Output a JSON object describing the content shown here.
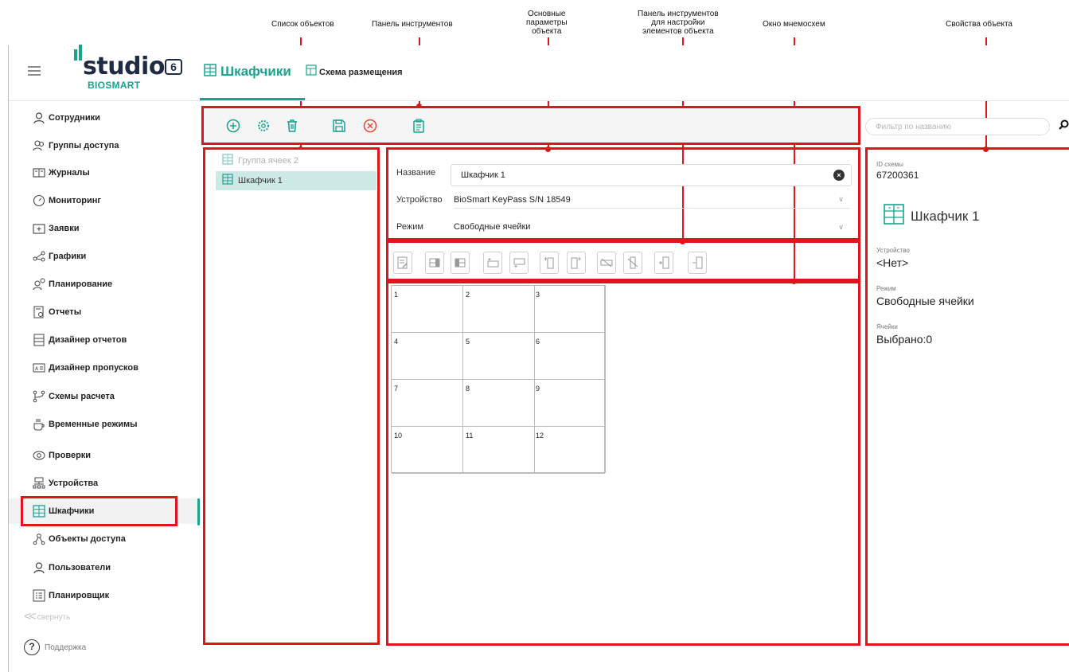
{
  "callouts": {
    "object_list": "Список объектов",
    "toolbar": "Панель инструментов",
    "main_params_1": "Основные",
    "main_params_2": "параметры",
    "main_params_3": "объекта",
    "element_toolbar_1": "Панель инструментов",
    "element_toolbar_2": "для настройки",
    "element_toolbar_3": "элементов объекта",
    "mnemonic_window": "Окно мнемосхем",
    "object_properties": "Свойства объекта"
  },
  "logo": {
    "word": "studio",
    "version": "6",
    "sub": "BIOSMART"
  },
  "tabs": [
    {
      "label": "Шкафчики",
      "icon": "locker-grid-icon",
      "active": true
    },
    {
      "label": "Схема размещения",
      "icon": "layout-scheme-icon",
      "active": false
    }
  ],
  "sidebar": {
    "items": [
      {
        "label": "Сотрудники",
        "icon": "person-icon"
      },
      {
        "label": "Группы доступа",
        "icon": "group-icon"
      },
      {
        "label": "Журналы",
        "icon": "journal-icon"
      },
      {
        "label": "Мониторинг",
        "icon": "gauge-icon"
      },
      {
        "label": "Заявки",
        "icon": "request-icon"
      },
      {
        "label": "Графики",
        "icon": "schedule-icon"
      },
      {
        "label": "Планирование",
        "icon": "planning-icon"
      },
      {
        "label": "Отчеты",
        "icon": "report-icon"
      },
      {
        "label": "Дизайнер отчетов",
        "icon": "report-designer-icon"
      },
      {
        "label": "Дизайнер пропусков",
        "icon": "pass-designer-icon"
      },
      {
        "label": "Схемы расчета",
        "icon": "calc-scheme-icon"
      },
      {
        "label": "Временные режимы",
        "icon": "time-mode-icon"
      },
      {
        "label": "Проверки",
        "icon": "eye-icon"
      },
      {
        "label": "Устройства",
        "icon": "devices-icon"
      },
      {
        "label": "Шкафчики",
        "icon": "locker-icon",
        "active": true
      },
      {
        "label": "Объекты доступа",
        "icon": "access-objects-icon"
      },
      {
        "label": "Пользователи",
        "icon": "user-icon"
      },
      {
        "label": "Планировщик",
        "icon": "scheduler-icon"
      }
    ],
    "collapse_label": "свернуть",
    "support_label": "Поддержка"
  },
  "toolbar": {
    "buttons": [
      "add-icon",
      "settings-icon",
      "delete-icon",
      "save-icon",
      "cancel-icon",
      "clipboard-icon"
    ]
  },
  "filter": {
    "placeholder": "Фильтр по названию"
  },
  "object_list": {
    "items": [
      {
        "label": "Группа ячеек 2",
        "muted": true
      },
      {
        "label": "Шкафчик 1",
        "selected": true
      }
    ]
  },
  "params": {
    "name_label": "Название",
    "name_value": "Шкафчик 1",
    "device_label": "Устройство",
    "device_value": "BioSmart KeyPass S/N 18549",
    "mode_label": "Режим",
    "mode_value": "Свободные ячейки"
  },
  "element_toolbar": {
    "buttons": [
      "edit-icon",
      "cell-left-icon",
      "cell-right-icon",
      "row-add-above-icon",
      "row-add-below-icon",
      "col-add-left-icon",
      "col-add-right-icon",
      "hide-icon",
      "unlink-icon",
      "add-cell-icon",
      "remove-cell-icon"
    ]
  },
  "grid": {
    "columns": 3,
    "cells": [
      "1",
      "2",
      "3",
      "4",
      "5",
      "6",
      "7",
      "8",
      "9",
      "10",
      "11",
      "12"
    ]
  },
  "properties": {
    "id_caption": "ID схемы",
    "id_value": "67200361",
    "title": "Шкафчик 1",
    "device_caption": "Устройство",
    "device_value": "<Нет>",
    "mode_caption": "Режим",
    "mode_value": "Свободные ячейки",
    "cells_caption": "Ячейки",
    "cells_value": "Выбрано:0"
  },
  "colors": {
    "accent": "#1aa38e",
    "callout": "#e1141b",
    "selected": "#cde9e5",
    "danger": "#e8492f"
  }
}
